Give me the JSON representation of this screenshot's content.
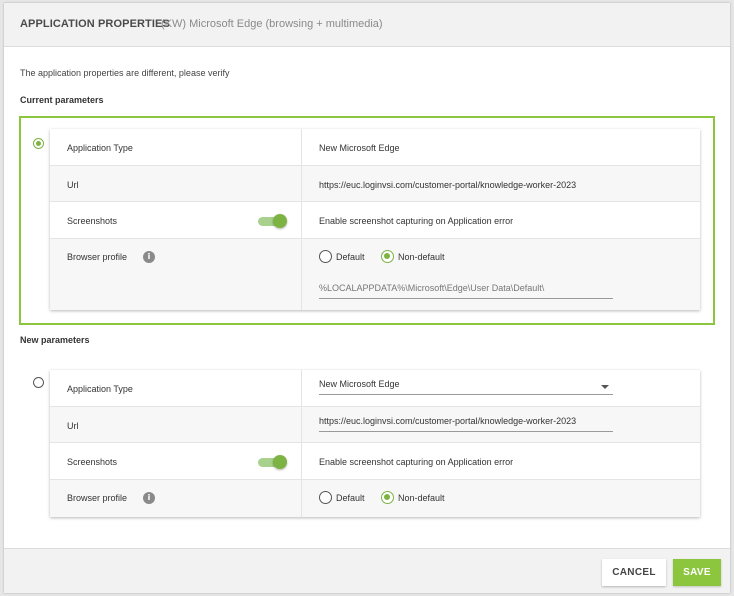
{
  "dialog": {
    "title": "APPLICATION PROPERTIES",
    "subtitle": "(KW) Microsoft Edge (browsing + multimedia)",
    "notice": "The application properties are different, please verify"
  },
  "current": {
    "section_label": "Current parameters",
    "selected": true,
    "rows": {
      "app_type": {
        "label": "Application Type",
        "value": "New Microsoft Edge"
      },
      "url": {
        "label": "Url",
        "value": "https://euc.loginvsi.com/customer-portal/knowledge-worker-2023"
      },
      "screenshots": {
        "label": "Screenshots",
        "toggle_on": true,
        "value": "Enable screenshot capturing on Application error"
      },
      "browser_profile": {
        "label": "Browser profile",
        "info_icon": "i",
        "option_default": "Default",
        "option_nondefault": "Non-default",
        "selected": "Non-default",
        "path": "%LOCALAPPDATA%\\Microsoft\\Edge\\User Data\\Default\\"
      }
    }
  },
  "new": {
    "section_label": "New parameters",
    "selected": false,
    "rows": {
      "app_type": {
        "label": "Application Type",
        "value": "New Microsoft Edge"
      },
      "url": {
        "label": "Url",
        "value": "https://euc.loginvsi.com/customer-portal/knowledge-worker-2023"
      },
      "screenshots": {
        "label": "Screenshots",
        "toggle_on": true,
        "value": "Enable screenshot capturing on Application error"
      },
      "browser_profile": {
        "label": "Browser profile",
        "info_icon": "i",
        "option_default": "Default",
        "option_nondefault": "Non-default",
        "selected": "Non-default"
      }
    }
  },
  "footer": {
    "cancel_label": "CANCEL",
    "save_label": "SAVE"
  },
  "colors": {
    "accent": "#8cc63f",
    "toggle_thumb": "#7cb342",
    "toggle_track": "#a9d18e"
  }
}
